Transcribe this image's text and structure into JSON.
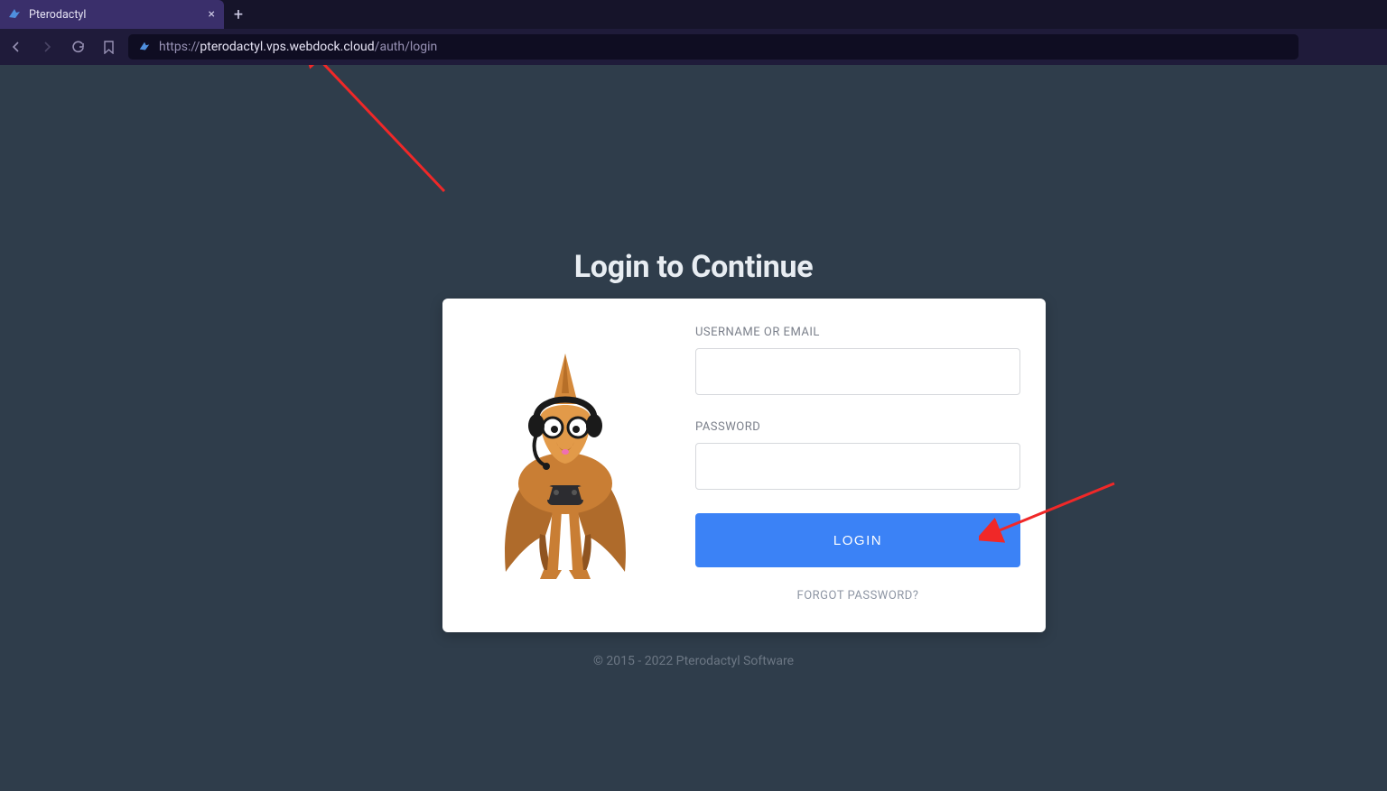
{
  "browser": {
    "tab_title": "Pterodactyl",
    "url_protocol": "https://",
    "url_host": "pterodactyl.vps.webdock.cloud",
    "url_path": "/auth/login"
  },
  "page": {
    "heading": "Login to Continue",
    "username_label": "USERNAME OR EMAIL",
    "password_label": "PASSWORD",
    "login_button": "LOGIN",
    "forgot_link": "FORGOT PASSWORD?",
    "footer": "© 2015 - 2022 Pterodactyl Software"
  }
}
